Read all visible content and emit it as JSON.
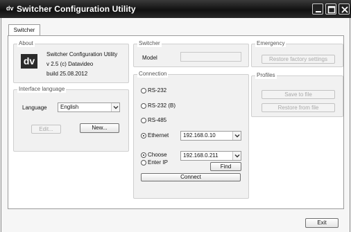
{
  "window": {
    "logo_text": "dv",
    "title": "Switcher Configuration Utility",
    "minimize_icon": "minimize-icon",
    "maximize_icon": "maximize-icon",
    "close_icon": "close-icon"
  },
  "tabs": [
    {
      "label": "Switcher"
    }
  ],
  "about": {
    "title": "About",
    "logo_text": "dv",
    "name": "Switcher Configuration Utility",
    "version": "v 2.5  (c) Datavideo",
    "build": "build  25.08.2012"
  },
  "interface_language": {
    "title": "Interface language",
    "language_label": "Language",
    "selected": "English",
    "edit_label": "Edit...",
    "new_label": "New..."
  },
  "switcher": {
    "title": "Switcher",
    "model_label": "Model",
    "model_value": ""
  },
  "connection": {
    "title": "Connection",
    "options": [
      {
        "label": "RS-232",
        "checked": false
      },
      {
        "label": "RS-232 (B)",
        "checked": false
      },
      {
        "label": "RS-485",
        "checked": false
      },
      {
        "label": "Ethernet",
        "checked": true
      }
    ],
    "ethernet_ip": "192.168.0.10",
    "choose_label": "Choose",
    "choose_checked": true,
    "choose_ip": "192.168.0.211",
    "enter_ip_label": "Enter IP",
    "enter_ip_checked": false,
    "find_label": "Find",
    "connect_label": "Connect"
  },
  "emergency": {
    "title": "Emergency",
    "restore_factory_label": "Restore factory settings"
  },
  "profiles": {
    "title": "Profiles",
    "save_label": "Save to file",
    "restore_label": "Restore from file"
  },
  "footer": {
    "exit_label": "Exit"
  }
}
